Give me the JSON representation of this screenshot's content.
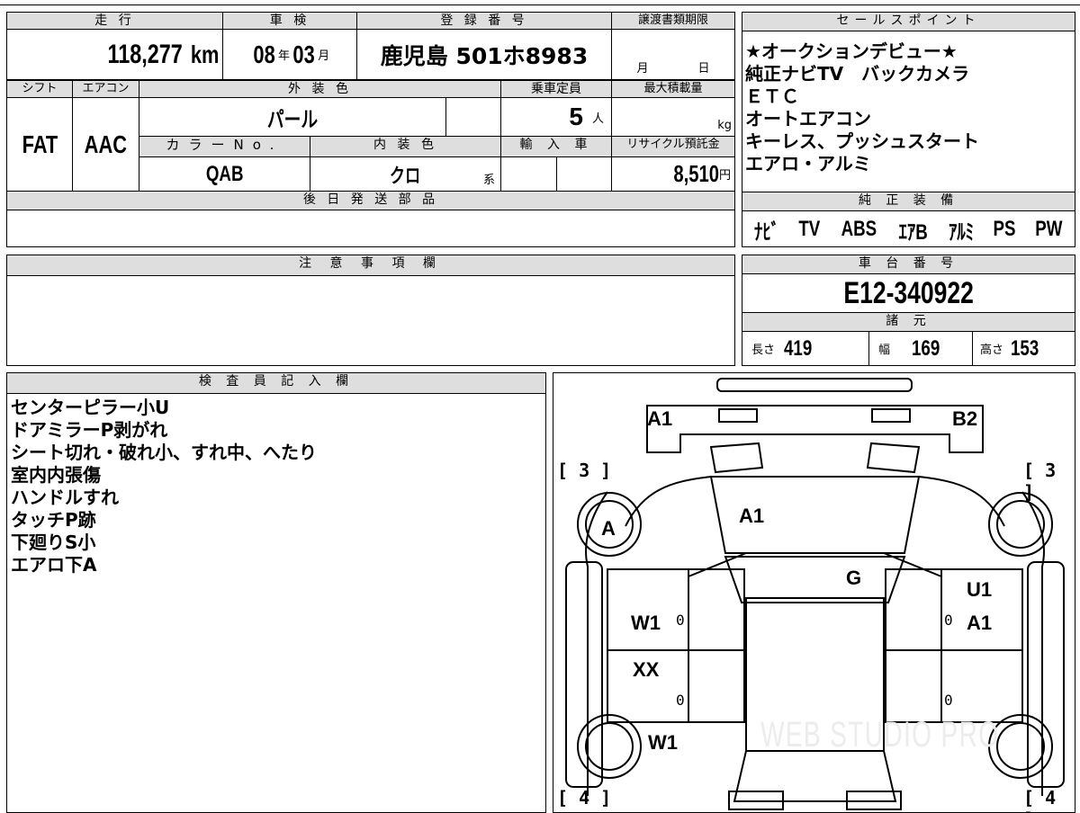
{
  "vehicle_info": {
    "mileage_label": "走 行",
    "mileage_value": "118,277",
    "mileage_unit": "km",
    "inspection_label": "車 検",
    "inspection_year": "08",
    "inspection_year_unit": "年",
    "inspection_month": "03",
    "inspection_month_unit": "月",
    "registration_label": "登 録 番 号",
    "registration_value": "鹿児島 501ホ8983",
    "transfer_deadline_label": "譲渡書類期限",
    "transfer_month_unit": "月",
    "transfer_day_unit": "日",
    "shift_label": "シフト",
    "shift_value": "FAT",
    "aircon_label": "エアコン",
    "aircon_value": "AAC",
    "exterior_color_label": "外 装 色",
    "exterior_color_value": "パール",
    "capacity_label": "乗車定員",
    "capacity_value": "5",
    "capacity_unit": "人",
    "max_load_label": "最大積載量",
    "max_load_unit": "kg",
    "color_no_label": "カラーNo.",
    "color_no_value": "QAB",
    "interior_color_label": "内 装 色",
    "interior_color_value": "クロ",
    "interior_color_suffix": "系",
    "import_label": "輸 入 車",
    "recycle_fee_label": "リサイクル預託金",
    "recycle_fee_value": "8,510",
    "recycle_fee_unit": "円",
    "later_parts_label": "後 日 発 送 部 品"
  },
  "sales_points": {
    "label": "セールスポイント",
    "lines": [
      "★オークションデビュー★",
      "純正ナビTV　バックカメラ",
      "ＥＴＣ",
      "オートエアコン",
      "キーレス、プッシュスタート",
      "エアロ・アルミ"
    ]
  },
  "factory_equipment": {
    "label": "純 正 装 備",
    "items": [
      "ﾅﾋﾞ",
      "TV",
      "ABS",
      "ｴｱB",
      "ｱﾙﾐ",
      "PS",
      "PW"
    ]
  },
  "notes": {
    "label": "注 意 事 項 欄"
  },
  "chassis": {
    "label": "車 台 番 号",
    "value": "E12-340922"
  },
  "specs": {
    "label": "諸 元",
    "length_label": "長さ",
    "length_value": "419",
    "width_label": "幅",
    "width_value": "169",
    "height_label": "高さ",
    "height_value": "153"
  },
  "inspector": {
    "label": "検 査 員 記 入 欄",
    "lines": [
      "センターピラー小U",
      "ドアミラーP剥がれ",
      "シート切れ・破れ小、すれ中、へたり",
      "室内内張傷",
      "ハンドルすれ",
      "タッチP跡",
      "下廻りS小",
      "エアロ下A"
    ]
  },
  "diagram": {
    "tire_front_left": "[ 3 ]",
    "tire_front_right": "[ 3 ]",
    "tire_rear_left": "[ 4 ]",
    "tire_rear_right": "[ 4 ]",
    "marks": {
      "front_bumper_left": "A1",
      "front_bumper_right": "B2",
      "front_left_wheel": "A",
      "hood": "A1",
      "windshield": "G",
      "right_front_door_top": "U1",
      "right_front_door": "A1",
      "left_front_door": "W1",
      "left_rear_door": "XX",
      "left_rear_wheel": "W1"
    },
    "zeros": [
      "0",
      "0",
      "0",
      "0"
    ],
    "watermark": "WEB STUDIO PRO"
  }
}
